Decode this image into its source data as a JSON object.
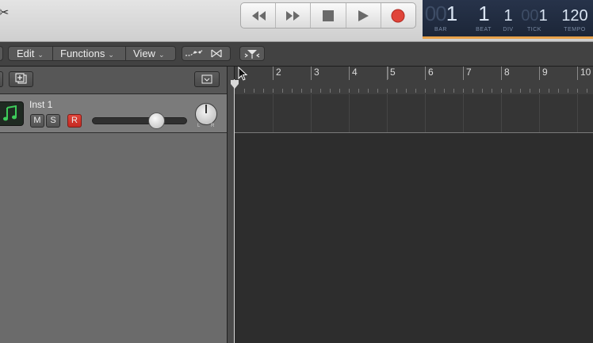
{
  "control_bar": {
    "left_glyph": "✂",
    "transport": [
      "rewind-button",
      "fast-forward-button",
      "stop-button",
      "play-button",
      "record-button"
    ],
    "lcd": {
      "bar": {
        "dim": "00",
        "value": "1",
        "label": "BAR"
      },
      "beat": {
        "value": "1",
        "label": "BEAT"
      },
      "div": {
        "value": "1",
        "label": "DIV"
      },
      "tick": {
        "dim": "00",
        "value": "1",
        "label": "TICK"
      },
      "tempo": {
        "value": "120",
        "label": "TEMPO"
      }
    }
  },
  "menu": {
    "edit": "Edit",
    "functions": "Functions",
    "view": "View"
  },
  "track": {
    "name": "Inst 1",
    "mute": "M",
    "solo": "S",
    "record": "R",
    "pan_left": "L",
    "pan_right": "R",
    "volume_level": 0.72
  },
  "ruler": {
    "bars": [
      "2",
      "3",
      "4",
      "5",
      "6",
      "7",
      "8",
      "9",
      "10"
    ]
  },
  "colors": {
    "record_red": "#e0453a",
    "lcd_bg": "#1c2638",
    "lcd_accent": "#e8a24a",
    "instrument_icon": "#3dcc5a"
  }
}
